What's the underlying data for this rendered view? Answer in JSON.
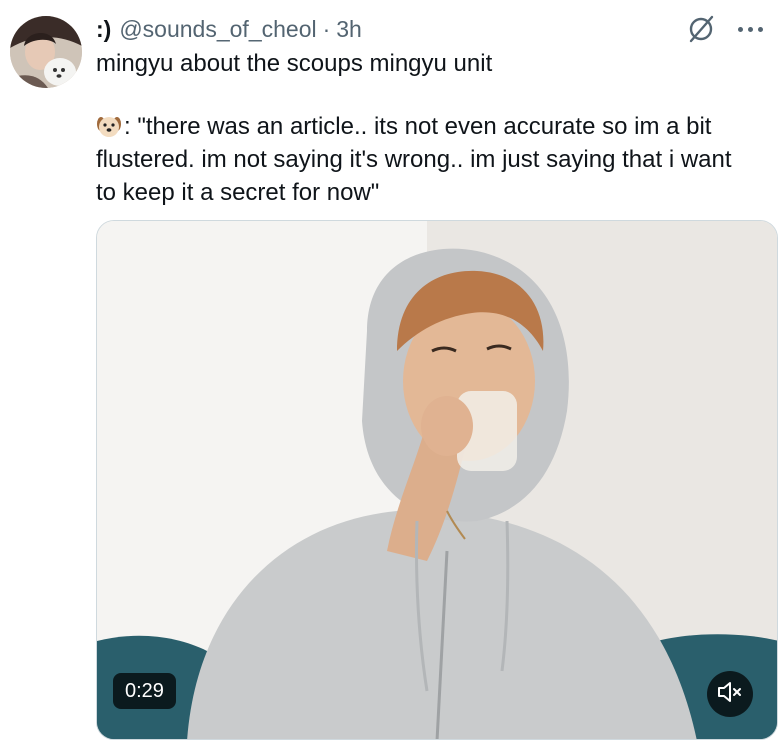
{
  "tweet": {
    "display_name": ":)",
    "handle": "@sounds_of_cheol",
    "separator": "·",
    "time": "3h",
    "text_line1": "mingyu about the scoups mingyu unit",
    "quote_emoji": "dog-face-icon",
    "quote_line1": ": \"there was an article.. its not even accurate so im a bit",
    "quote_line2": "flustered. im not saying it's wrong.. im just saying that i want",
    "quote_line3": "to keep it a secret for now\""
  },
  "video": {
    "duration": "0:29",
    "mute_icon": "volume-muted-icon"
  },
  "icons": {
    "grok": "grok-icon",
    "more": "more-icon"
  },
  "colors": {
    "text": "#0f1419",
    "secondary": "#536471",
    "hoodie": "#c9cbcc",
    "sofa": "#1f4f5c"
  }
}
